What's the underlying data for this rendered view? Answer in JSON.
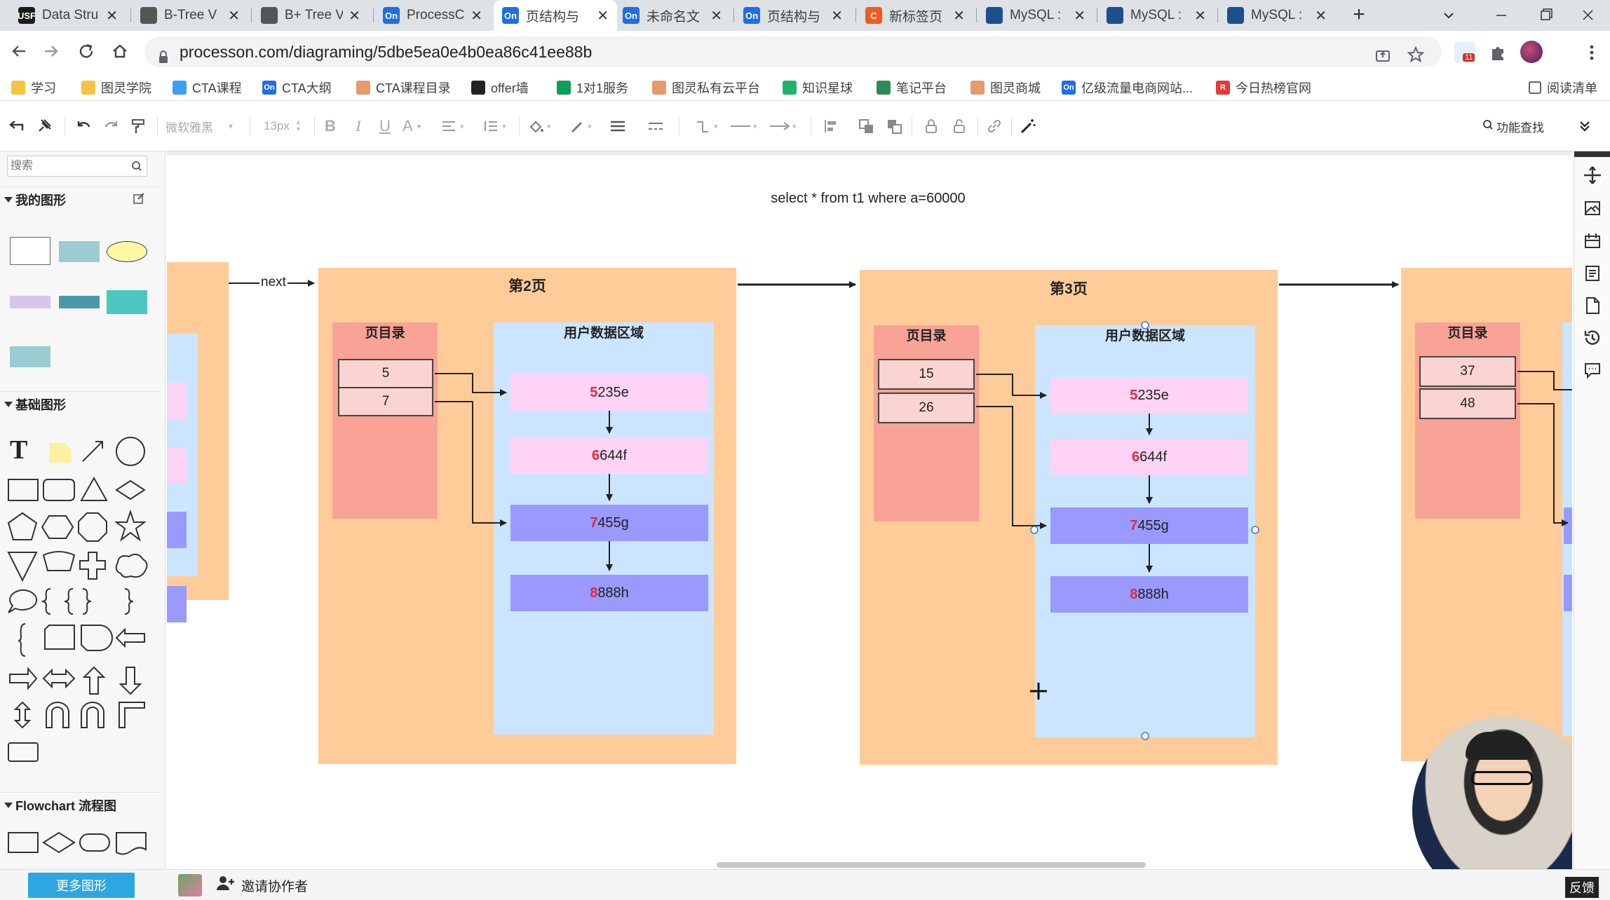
{
  "browser": {
    "tabs": [
      {
        "label": "Data Stru",
        "favicon": "USF",
        "favicon_color": "#1a1a1a"
      },
      {
        "label": "B-Tree V",
        "favicon": "globe-icon",
        "favicon_color": "#555"
      },
      {
        "label": "B+ Tree V",
        "favicon": "globe-icon",
        "favicon_color": "#555"
      },
      {
        "label": "ProcessC",
        "favicon": "On",
        "favicon_color": "#1f6fe0"
      },
      {
        "label": "页结构与",
        "favicon": "On",
        "favicon_color": "#1f6fe0"
      },
      {
        "label": "未命名文",
        "favicon": "On",
        "favicon_color": "#1f6fe0"
      },
      {
        "label": "页结构与",
        "favicon": "On",
        "favicon_color": "#1f6fe0"
      },
      {
        "label": "新标签页",
        "favicon": "C",
        "favicon_color": "#f05a24"
      },
      {
        "label": "MySQL :",
        "favicon": "mysql-icon",
        "favicon_color": "#1d4f8c"
      },
      {
        "label": "MySQL :",
        "favicon": "mysql-icon",
        "favicon_color": "#1d4f8c"
      },
      {
        "label": "MySQL :",
        "favicon": "mysql-icon",
        "favicon_color": "#1d4f8c"
      }
    ],
    "active_tab": 4,
    "url": "processon.com/diagraming/5dbe5ea0e4b0ea86c41ee88b",
    "extension_badge": "11",
    "bookmarks": [
      {
        "label": "学习",
        "icon": "folder-icon",
        "color": "#f6c343"
      },
      {
        "label": "图灵学院",
        "icon": "folder-icon",
        "color": "#f6c343"
      },
      {
        "label": "CTA课程",
        "icon": "diamond-icon",
        "color": "#3a9ff5"
      },
      {
        "label": "CTA大纲",
        "icon": "On",
        "color": "#1f6fe0"
      },
      {
        "label": "CTA课程目录",
        "icon": "wave-icon",
        "color": "#e39b6c"
      },
      {
        "label": "offer墙",
        "icon": "github-icon",
        "color": "#222"
      },
      {
        "label": "1对1服务",
        "icon": "sheet-icon",
        "color": "#0f9d58"
      },
      {
        "label": "图灵私有云平台",
        "icon": "wave-icon",
        "color": "#e39b6c"
      },
      {
        "label": "知识星球",
        "icon": "ring-icon",
        "color": "#21b26b"
      },
      {
        "label": "笔记平台",
        "icon": "leaf-icon",
        "color": "#2e8b57"
      },
      {
        "label": "图灵商城",
        "icon": "wave-icon",
        "color": "#e39b6c"
      },
      {
        "label": "亿级流量电商网站...",
        "icon": "On",
        "color": "#1f6fe0"
      },
      {
        "label": "今日热榜官网",
        "icon": "R",
        "color": "#e53935"
      }
    ],
    "reading_list": "阅读清单"
  },
  "toolbar": {
    "font_name": "微软雅黑",
    "font_size": "13px",
    "feature_search": "功能查找"
  },
  "sidebar": {
    "search_placeholder": "搜索",
    "my_shapes": "我的图形",
    "basic_shapes": "基础图形",
    "flowchart": "Flowchart 流程图",
    "more_shapes": "更多图形"
  },
  "bottom": {
    "invite": "邀请协作者",
    "feedback": "反馈"
  },
  "diagram": {
    "sql": "select * from t1 where a=60000",
    "next_label": "next",
    "pages": [
      {
        "title": "第2页",
        "dir_label": "页目录",
        "dir_slots": [
          "5",
          "7"
        ],
        "data_label": "用户数据区域",
        "records": [
          {
            "key": "5",
            "rest": "235e",
            "color": "#ffd3f5"
          },
          {
            "key": "6",
            "rest": "644f",
            "color": "#ffd3f5"
          },
          {
            "key": "7",
            "rest": "455g",
            "color": "#9999ff"
          },
          {
            "key": "8",
            "rest": "888h",
            "color": "#9999ff"
          }
        ]
      },
      {
        "title": "第3页",
        "dir_label": "页目录",
        "dir_slots": [
          "15",
          "26"
        ],
        "data_label": "用户数据区域",
        "records": [
          {
            "key": "5",
            "rest": "235e",
            "color": "#ffd3f5"
          },
          {
            "key": "6",
            "rest": "644f",
            "color": "#ffd3f5"
          },
          {
            "key": "7",
            "rest": "455g",
            "color": "#9999ff"
          },
          {
            "key": "8",
            "rest": "888h",
            "color": "#9999ff"
          }
        ]
      },
      {
        "title": "",
        "dir_label": "页目录",
        "dir_slots": [
          "37",
          "48"
        ]
      }
    ],
    "colors": {
      "page_bg": "#ffcc99",
      "dir_bg": "#f8a395",
      "data_bg": "#cce5ff",
      "record_pink": "#ffd3f5",
      "record_blue": "#9999ff",
      "key_red": "#e0293a"
    }
  }
}
